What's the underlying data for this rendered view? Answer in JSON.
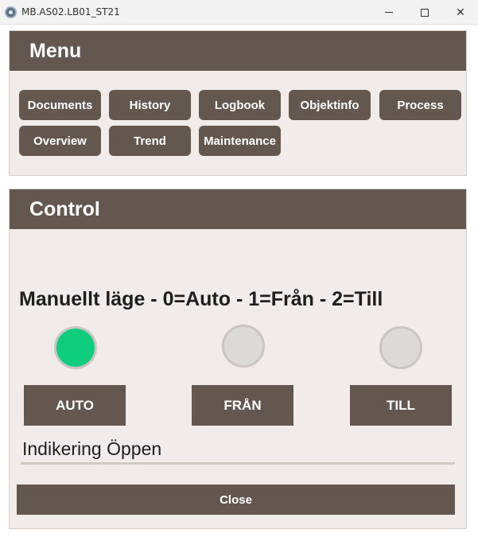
{
  "window": {
    "title": "MB.AS02.LB01_ST21",
    "icon": "app-gear-icon",
    "minimize_glyph": "",
    "maximize_glyph": "",
    "close_glyph": "✕"
  },
  "menu": {
    "title": "Menu",
    "buttons": [
      {
        "label": "Documents"
      },
      {
        "label": "History"
      },
      {
        "label": "Logbook"
      },
      {
        "label": "Objektinfo"
      },
      {
        "label": "Process"
      },
      {
        "label": "Overview"
      },
      {
        "label": "Trend"
      },
      {
        "label": "Maintenance"
      }
    ]
  },
  "control": {
    "title": "Control",
    "mode_label": "Manuellt läge - 0=Auto - 1=Från - 2=Till",
    "active_mode": "AUTO",
    "modes": [
      {
        "label": "AUTO",
        "active": true
      },
      {
        "label": "FRÅN",
        "active": false
      },
      {
        "label": "TILL",
        "active": false
      }
    ],
    "indication": "Indikering Öppen",
    "close_label": "Close"
  },
  "colors": {
    "header_bg": "#635750",
    "panel_bg": "#f1ecea",
    "lamp_on": "#10cc7e",
    "lamp_off": "#dcdad9",
    "button_text": "#ffffff"
  }
}
